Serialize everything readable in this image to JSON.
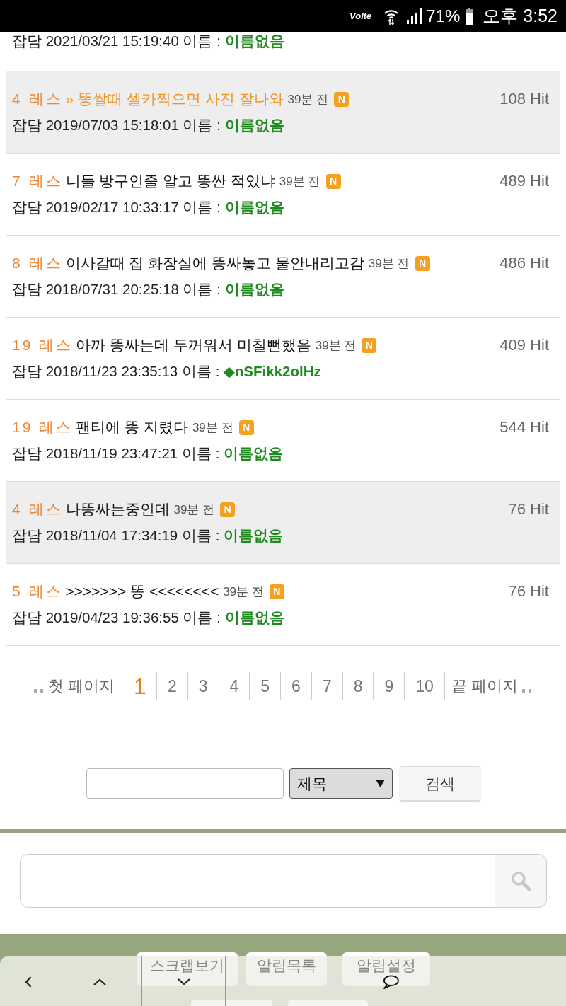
{
  "status_bar": {
    "network": "Volte",
    "battery": "71%",
    "time": "오후 3:52"
  },
  "cut_off_post": {
    "meta": "잡담 2021/03/21 15:19:40 이름 : **이름없음**"
  },
  "posts": [
    {
      "replies": "4 레스",
      "title": "» 똥쌀때 셀카찍으면 사진 잘나와",
      "age": "39분 전",
      "badge": "N",
      "hits": "108 Hit",
      "meta": "잡담 2019/07/03 15:18:01 이름 : **이름없음**",
      "selected": true,
      "shaded": true
    },
    {
      "replies": "7 레스",
      "title": "니들 방구인줄 알고 똥싼 적있냐",
      "age": "39분 전",
      "badge": "N",
      "hits": "489 Hit",
      "meta": "잡담 2019/02/17 10:33:17 이름 : **이름없음**",
      "selected": false,
      "shaded": false
    },
    {
      "replies": "8 레스",
      "title": "이사갈때 집 화장실에 똥싸놓고 물안내리고감",
      "age": "39분 전",
      "badge": "N",
      "hits": "486 Hit",
      "meta": "잡담 2018/07/31 20:25:18 이름 : **이름없음**",
      "selected": false,
      "shaded": false
    },
    {
      "replies": "19 레스",
      "title": "아까 똥싸는데 두꺼워서 미칠뻔했음",
      "age": "39분 전",
      "badge": "N",
      "hits": "409 Hit",
      "meta": "잡담 2018/11/23 23:35:13 이름 : **◆nSFikk2olHz**",
      "selected": false,
      "shaded": false
    },
    {
      "replies": "19 레스",
      "title": "팬티에 똥 지렸다",
      "age": "39분 전",
      "badge": "N",
      "hits": "544 Hit",
      "meta": "잡담 2018/11/19 23:47:21 이름 : **이름없음**",
      "selected": false,
      "shaded": false
    },
    {
      "replies": "4 레스",
      "title": "나똥싸는중인데",
      "age": "39분 전",
      "badge": "N",
      "hits": "76 Hit",
      "meta": "잡담 2018/11/04 17:34:19 이름 : **이름없음**",
      "selected": false,
      "shaded": true
    },
    {
      "replies": "5 레스",
      "title": ">>>>>>> 똥 <<<<<<<<",
      "age": "39분 전",
      "badge": "N",
      "hits": "76 Hit",
      "meta": "잡담 2019/04/23 19:36:55 이름 : **이름없음**",
      "selected": false,
      "shaded": false
    }
  ],
  "pagination": {
    "first": "첫 페이지",
    "pages": [
      {
        "label": "1",
        "selected": true
      },
      {
        "label": "2",
        "selected": false
      },
      {
        "label": "3",
        "selected": false
      },
      {
        "label": "4",
        "selected": false
      },
      {
        "label": "5",
        "selected": false
      },
      {
        "label": "6",
        "selected": false
      },
      {
        "label": "7",
        "selected": false
      },
      {
        "label": "8",
        "selected": false
      },
      {
        "label": "9",
        "selected": false
      },
      {
        "label": "10",
        "selected": false
      }
    ],
    "last": "끝 페이지"
  },
  "search_form": {
    "scope": "제목",
    "button": "검색"
  },
  "bottom_menu": [
    "스크랩보기",
    "알림목록",
    "알림설정"
  ]
}
